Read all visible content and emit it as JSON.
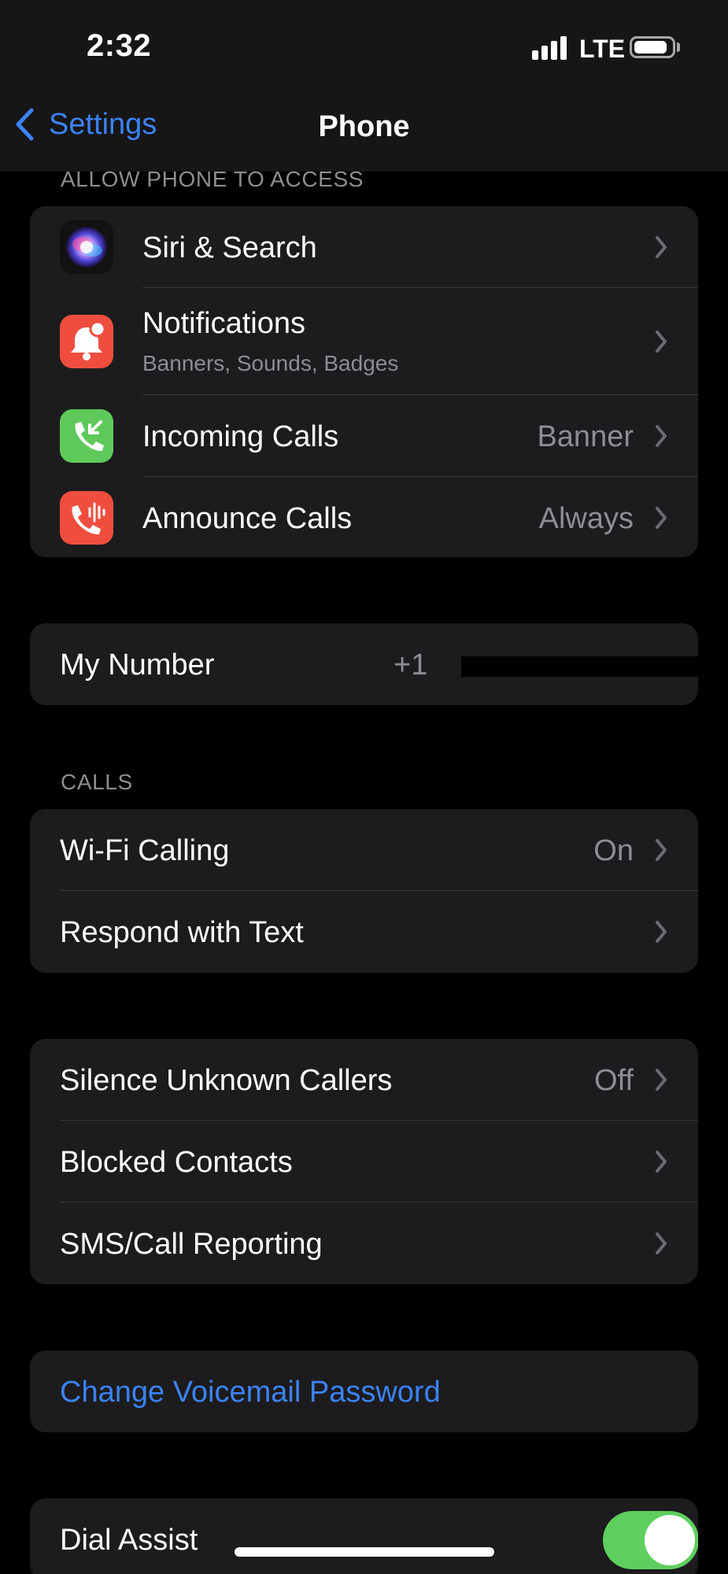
{
  "status_bar": {
    "time": "2:32",
    "network": "LTE",
    "battery_level": 0.9,
    "signal_bars": 4
  },
  "nav": {
    "back_label": "Settings",
    "title": "Phone"
  },
  "section_access": {
    "header": "ALLOW PHONE TO ACCESS",
    "items": [
      {
        "label": "Siri & Search",
        "icon": "siri-icon"
      },
      {
        "label": "Notifications",
        "sublabel": "Banners, Sounds, Badges",
        "icon": "notifications-icon"
      },
      {
        "label": "Incoming Calls",
        "value": "Banner",
        "icon": "incoming-call-icon"
      },
      {
        "label": "Announce Calls",
        "value": "Always",
        "icon": "announce-calls-icon"
      }
    ]
  },
  "my_number": {
    "label": "My Number",
    "value": "+1"
  },
  "section_calls": {
    "header": "CALLS",
    "items": [
      {
        "label": "Wi-Fi Calling",
        "value": "On"
      },
      {
        "label": "Respond with Text"
      }
    ]
  },
  "section_blocking": {
    "items": [
      {
        "label": "Silence Unknown Callers",
        "value": "Off"
      },
      {
        "label": "Blocked Contacts"
      },
      {
        "label": "SMS/Call Reporting"
      }
    ]
  },
  "voicemail": {
    "label": "Change Voicemail Password"
  },
  "dial_assist": {
    "label": "Dial Assist",
    "enabled": true
  },
  "colors": {
    "accent_blue": "#3b82f6",
    "toggle_on": "#5ecf5f",
    "notifications_red": "#ef4e3f",
    "incoming_green": "#5ec95a"
  }
}
